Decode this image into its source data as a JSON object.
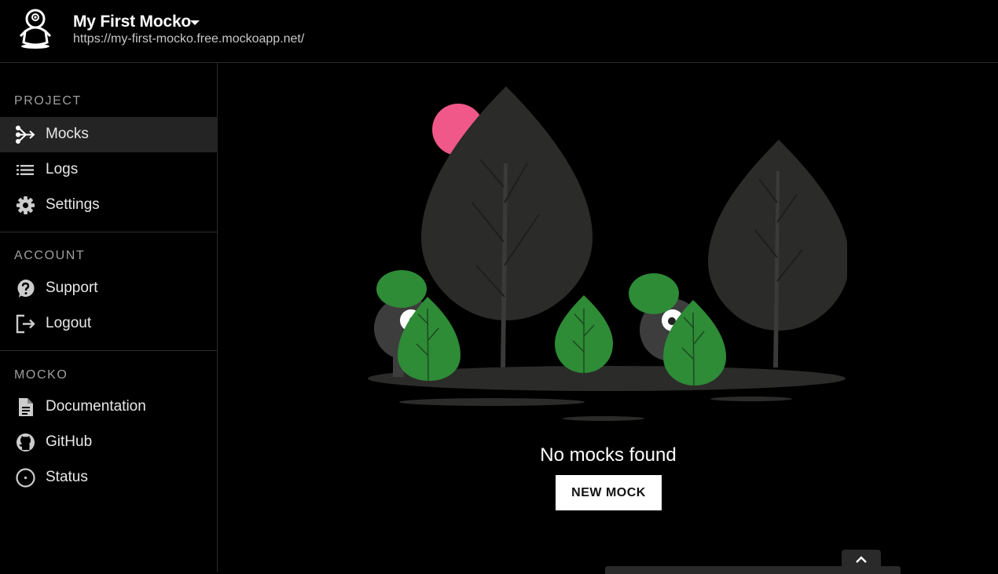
{
  "header": {
    "project_name": "My First Mocko",
    "project_url": "https://my-first-mocko.free.mockoapp.net/"
  },
  "sidebar": {
    "sections": [
      {
        "title": "PROJECT",
        "items": [
          {
            "label": "Mocks",
            "icon": "mocks-icon",
            "active": true
          },
          {
            "label": "Logs",
            "icon": "list-icon"
          },
          {
            "label": "Settings",
            "icon": "gear-icon"
          }
        ]
      },
      {
        "title": "ACCOUNT",
        "items": [
          {
            "label": "Support",
            "icon": "help-icon"
          },
          {
            "label": "Logout",
            "icon": "logout-icon"
          }
        ]
      },
      {
        "title": "MOCKO",
        "items": [
          {
            "label": "Documentation",
            "icon": "document-icon"
          },
          {
            "label": "GitHub",
            "icon": "github-icon"
          },
          {
            "label": "Status",
            "icon": "status-icon"
          }
        ]
      }
    ]
  },
  "main": {
    "empty_message": "No mocks found",
    "new_button_label": "NEW MOCK"
  },
  "colors": {
    "background": "#000000",
    "sidebar_active": "#242424",
    "tree": "#2b2b29",
    "leaf": "#2e8b36",
    "sun": "#f0588a"
  }
}
